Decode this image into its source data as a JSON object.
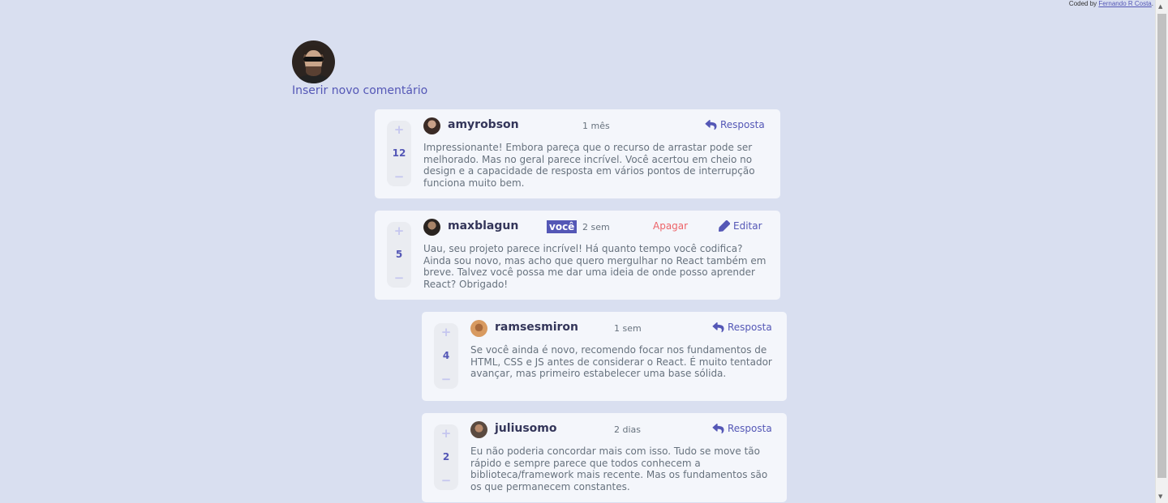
{
  "credit": {
    "prefix": "Coded by ",
    "author": "Fernando R Costa",
    "suffix": "."
  },
  "header": {
    "insert_link": "Inserir novo comentário"
  },
  "you_badge": "você",
  "comments": [
    {
      "username": "amyrobson",
      "time": "1 mês",
      "score": "12",
      "action": "Resposta",
      "text": "Impressionante! Embora pareça que o recurso de arrastar pode ser melhorado. Mas no geral parece incrível. Você acertou em cheio no design e a capacidade de resposta em vários pontos de interrupção funciona muito bem."
    },
    {
      "username": "maxblagun",
      "time": "2 sem",
      "score": "5",
      "delete_label": "Apagar",
      "edit_label": "Editar",
      "text": "Uau, seu projeto parece incrível! Há quanto tempo você codifica? Ainda sou novo, mas acho que quero mergulhar no React também em breve. Talvez você possa me dar uma ideia de onde posso aprender React? Obrigado!"
    },
    {
      "username": "ramsesmiron",
      "time": "1 sem",
      "score": "4",
      "action": "Resposta",
      "text": "Se você ainda é novo, recomendo focar nos fundamentos de HTML, CSS e JS antes de considerar o React. É muito tentador avançar, mas primeiro estabelecer uma base sólida."
    },
    {
      "username": "juliusomo",
      "time": "2 dias",
      "score": "2",
      "action": "Resposta",
      "text": "Eu não poderia concordar mais com isso. Tudo se move tão rápido e sempre parece que todos conhecem a biblioteca/framework mais recente. Mas os fundamentos são os que permanecem constantes."
    }
  ],
  "vote": {
    "plus": "+",
    "minus": "−"
  },
  "colors": {
    "accent": "#5457b6",
    "danger": "#ed6368",
    "background": "#d9dff0",
    "card": "#f4f6fb"
  }
}
